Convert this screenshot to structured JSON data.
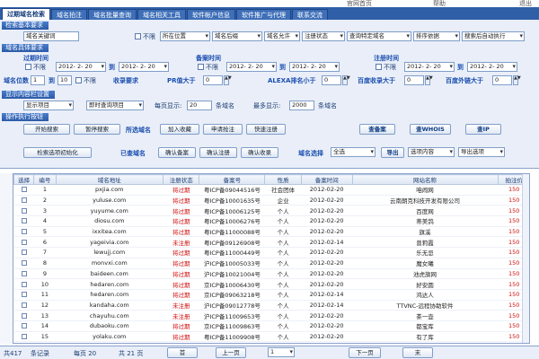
{
  "top_menu": [
    "官网首页",
    "帮助",
    "退出"
  ],
  "tabs": [
    "过期域名检索",
    "域名拍注",
    "域名批量查询",
    "域名相关工具",
    "软件帐户信息",
    "软件推广与代理",
    "联系交流"
  ],
  "sections": {
    "basic": "检索基本要求",
    "detail": "域名具体要求",
    "display": "显示内容栏设置",
    "operation": "操作执行按钮"
  },
  "basic": {
    "keyword_placeholder": "域名关键词",
    "no_limit": "不限",
    "position": "所在位置",
    "suffix": "域名后缀",
    "domain_type": "域名允许",
    "reg_status": "注册状态",
    "query_domain": "查询特定域名",
    "sort": "排序依据",
    "search_after": "搜索后自动执行"
  },
  "detail": {
    "expire_label": "过期时间",
    "to": "到",
    "date1": "2012- 2- 20",
    "date2": "2012- 2- 20",
    "record_label": "备案时间",
    "date3": "2012- 2- 20",
    "date4": "2012- 2- 20",
    "reg_label": "注册时间",
    "date5": "2012- 2- 20",
    "date6": "2012- 2- 20",
    "no_limit": "不限",
    "length_label": "域名位数",
    "len_from": "1",
    "len_to": "10",
    "include_label": "收录要求",
    "pr_label": "PR值大于",
    "alexa_label": "ALEXA排名小于",
    "baidu_label": "百度收录大于",
    "baidu_out_label": "百度外链大于",
    "zero": "0"
  },
  "display": {
    "show_option": "显示项目",
    "instant_query": "即时查询项目",
    "per_page_label": "每页显示:",
    "per_page": "20",
    "per_page_unit": "条域名",
    "max_label": "最多显示:",
    "max_value": "2000",
    "max_unit": "条域名"
  },
  "buttons": {
    "start": "开始搜索",
    "pause": "暂停搜索",
    "selected_label": "所选域名",
    "add_fav": "加入收藏",
    "apply_grab": "申请抢注",
    "quick_reg": "快速注册",
    "check_record": "查备案",
    "check_whois": "查WHOIS",
    "check_ip": "查IP",
    "filter_format": "检索选项初始化",
    "checked_label": "已查域名",
    "confirm_record": "确认备案",
    "confirm_reg": "确认注册",
    "confirm_include": "确认收录",
    "domain_select_label": "域名选择",
    "select_all": "全选",
    "export_label": "导出",
    "export_value": "选项内容",
    "export_options": "导出选项"
  },
  "table": {
    "headers": [
      "选择",
      "编号",
      "域名地址",
      "注册状态",
      "备案号",
      "性质",
      "备案时间",
      "网站名称",
      "拍注价"
    ],
    "rows": [
      [
        "1",
        "pxjia.com",
        "将过期",
        "粤ICP备09044516号",
        "社会团体",
        "2012-02-20",
        "咱闹网",
        "150"
      ],
      [
        "2",
        "yuluse.com",
        "将过期",
        "粤ICP备10001635号",
        "企业",
        "2012-02-20",
        "云南朗克科技开发有限公司",
        "150"
      ],
      [
        "3",
        "yuyume.com",
        "将过期",
        "粤ICP备10006125号",
        "个人",
        "2012-02-20",
        "百度网",
        "150"
      ],
      [
        "4",
        "diosu.com",
        "将过期",
        "粤ICP备10006276号",
        "个人",
        "2012-02-20",
        "蒂美鸽",
        "150"
      ],
      [
        "5",
        "ixxitea.com",
        "将过期",
        "粤ICP备11000088号",
        "个人",
        "2012-02-20",
        "旗溪",
        "150"
      ],
      [
        "6",
        "yageivia.com",
        "未注册",
        "粤ICP备09126908号",
        "个人",
        "2012-02-14",
        "曾莉霞",
        "150"
      ],
      [
        "7",
        "lewujj.com",
        "将过期",
        "粤ICP备11000449号",
        "个人",
        "2012-02-20",
        "乐无忌",
        "150"
      ],
      [
        "8",
        "monvxi.com",
        "将过期",
        "沪ICP备10005033号",
        "个人",
        "2012-02-20",
        "魔女曦",
        "150"
      ],
      [
        "9",
        "baideen.com",
        "将过期",
        "沪ICP备10021004号",
        "个人",
        "2012-02-20",
        "池虎旗网",
        "150"
      ],
      [
        "10",
        "hedaren.com",
        "将过期",
        "京ICP备10006430号",
        "个人",
        "2012-02-20",
        "好安圆",
        "150"
      ],
      [
        "11",
        "hedaren.com",
        "将过期",
        "京ICP备09063218号",
        "个人",
        "2012-02-14",
        "鸿达人",
        "150"
      ],
      [
        "12",
        "kandaha.com",
        "未注册",
        "沪ICP备09012778号",
        "个人",
        "2012-02-14",
        "TTVNC-远程协助软件",
        "150"
      ],
      [
        "13",
        "chayuhu.com",
        "未注册",
        "沪ICP备11009653号",
        "个人",
        "2012-02-20",
        "茶一壶",
        "150"
      ],
      [
        "14",
        "dubaoku.com",
        "将过期",
        "京ICP备11009863号",
        "个人",
        "2012-02-20",
        "都宝库",
        "150"
      ],
      [
        "15",
        "yolaku.com",
        "将过期",
        "粤ICP备11009908号",
        "个人",
        "2012-02-20",
        "有了库",
        "150"
      ]
    ]
  },
  "pager": {
    "total_label": "共417",
    "records": "条记录",
    "page_info": "每页 20",
    "page_count": "共 21 页",
    "first": "首",
    "prev": "上一页",
    "current": "1",
    "next": "下一页",
    "last": "末"
  },
  "colors": {
    "tab_bar": "#2f5fa6",
    "panel_bg": "#e9eef8",
    "section_header": "#2b5aa8",
    "expiring_text": "#d01010"
  }
}
